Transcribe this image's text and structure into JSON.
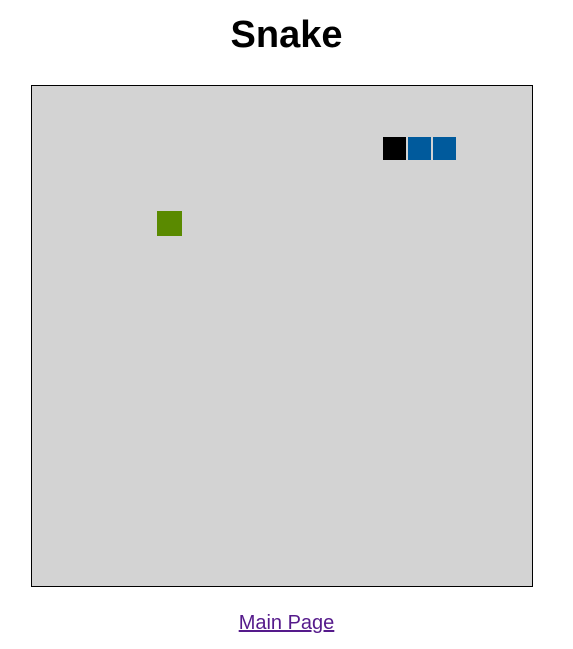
{
  "page": {
    "title": "Snake"
  },
  "game": {
    "grid_cols": 20,
    "grid_rows": 20,
    "colors": {
      "board_background": "#d3d3d3",
      "board_border": "#000000",
      "snake_head": "#000000",
      "snake_body": "#005a9c",
      "food": "#5a8a00"
    },
    "snake": [
      {
        "col": 14,
        "row": 2
      },
      {
        "col": 15,
        "row": 2
      },
      {
        "col": 16,
        "row": 2
      }
    ],
    "food": {
      "col": 5,
      "row": 5
    }
  },
  "footer": {
    "main_page_link": "Main Page"
  }
}
